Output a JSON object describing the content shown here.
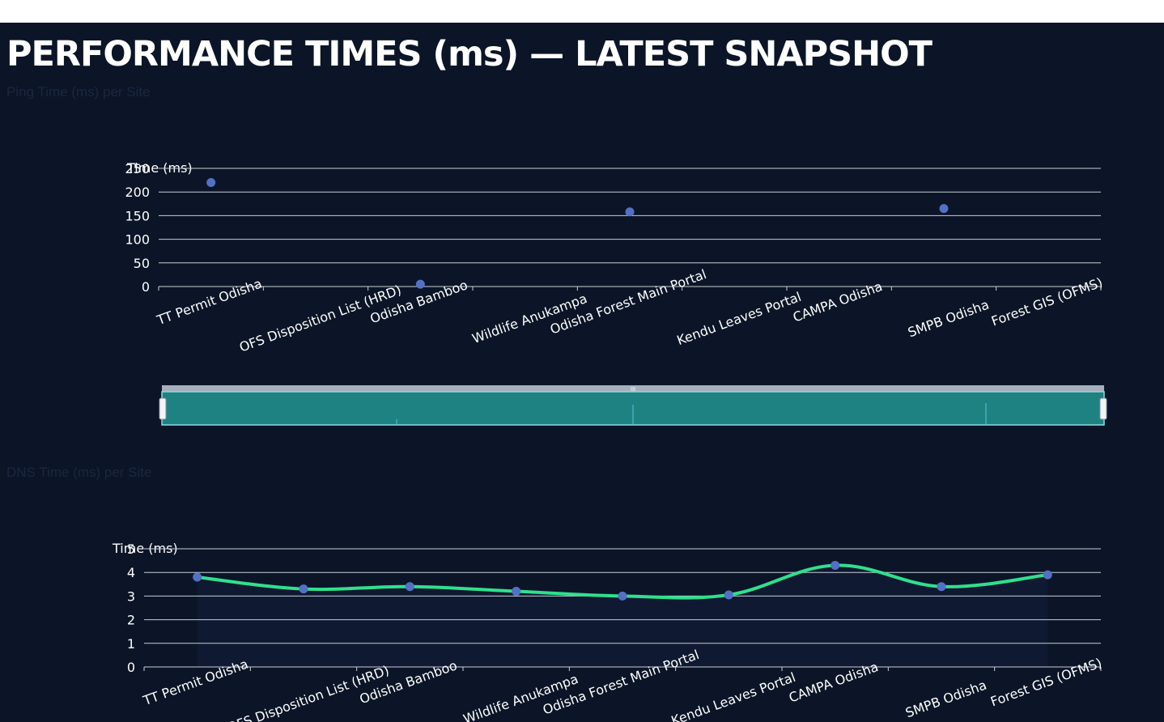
{
  "page": {
    "title": "PERFORMANCE TIMES (ms) — LATEST SNAPSHOT"
  },
  "colors": {
    "background": "#0b1527",
    "grid": "#c9ced6",
    "point": "#5470c6",
    "line": "#2fe08c",
    "area": "#0f1a33",
    "zoom_fill": "#1f8282",
    "zoom_handle": "#f2f4f7"
  },
  "chart_data": [
    {
      "type": "scatter",
      "title": "Ping Time (ms) per Site",
      "xlabel": "",
      "ylabel": "Time (ms)",
      "ylim": [
        0,
        250
      ],
      "yticks": [
        "0",
        "50",
        "100",
        "150",
        "200",
        "250"
      ],
      "categories": [
        "TT Permit Odisha",
        "OFS Disposition List (HRD)",
        "Odisha Bamboo",
        "Wildlife Anukampa",
        "Odisha Forest Main Portal",
        "Kendu Leaves Portal",
        "CAMPA Odisha",
        "SMPB Odisha",
        "Forest GIS (OFMS)"
      ],
      "points": [
        {
          "category": "TT Permit Odisha",
          "x": 0.5,
          "y": 220
        },
        {
          "category": "Odisha Bamboo",
          "x": 2.5,
          "y": 5
        },
        {
          "category": "Odisha Forest Main Portal",
          "x": 4.5,
          "y": 158
        },
        {
          "category": "SMPB Odisha",
          "x": 7.5,
          "y": 165
        }
      ],
      "grid": true,
      "data_zoom": {
        "start_percent": 0,
        "end_percent": 100
      }
    },
    {
      "type": "line",
      "title": "DNS Time (ms) per Site",
      "xlabel": "",
      "ylabel": "Time (ms)",
      "ylim": [
        0,
        5
      ],
      "yticks": [
        "0",
        "1",
        "2",
        "3",
        "4",
        "5"
      ],
      "categories": [
        "TT Permit Odisha",
        "OFS Disposition List (HRD)",
        "Odisha Bamboo",
        "Wildlife Anukampa",
        "Odisha Forest Main Portal",
        "Kendu Leaves Portal",
        "CAMPA Odisha",
        "SMPB Odisha",
        "Forest GIS (OFMS)"
      ],
      "values": [
        3.8,
        3.3,
        3.4,
        3.2,
        3.0,
        3.05,
        4.3,
        3.4,
        3.9
      ],
      "smooth": true,
      "area": true,
      "grid": true
    }
  ]
}
